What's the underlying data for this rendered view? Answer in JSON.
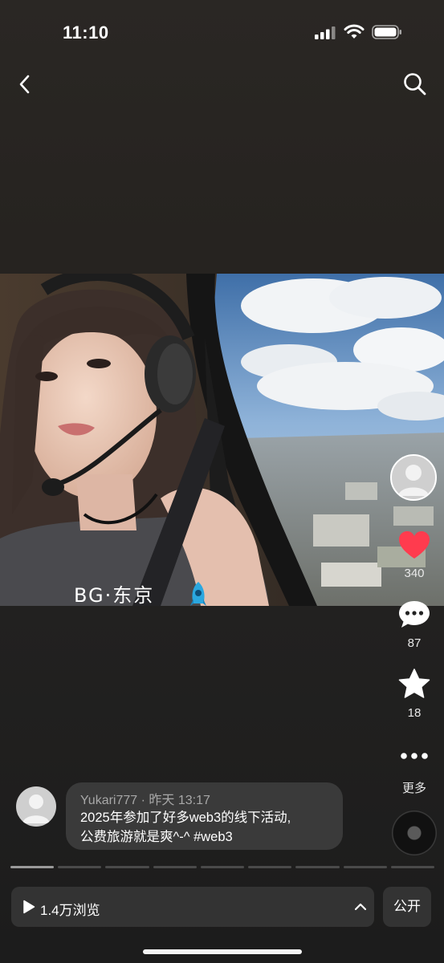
{
  "status_bar": {
    "time": "11:10"
  },
  "photo": {
    "overlay_text": "BG·东京"
  },
  "actions": {
    "like_count": "340",
    "comment_count": "87",
    "favorite_count": "18",
    "more_label": "更多"
  },
  "post": {
    "username": "Yukari777",
    "meta_separator": "·",
    "time": "昨天 13:17",
    "text_line1": "2025年参加了好多web3的线下活动,",
    "text_line2": "公费旅游就是爽^-^ #web3"
  },
  "pager": {
    "total": 9,
    "active_index": 0
  },
  "bottom_bar": {
    "views_label": "1.4万浏览",
    "visibility_label": "公开"
  },
  "colors": {
    "like": "#ff3b4e",
    "background": "#242220",
    "bubble": "#3a3a3a"
  },
  "icons": [
    "back-icon",
    "search-icon",
    "heart-icon",
    "comment-icon",
    "star-icon",
    "more-icon",
    "play-icon",
    "chevron-up-icon"
  ]
}
